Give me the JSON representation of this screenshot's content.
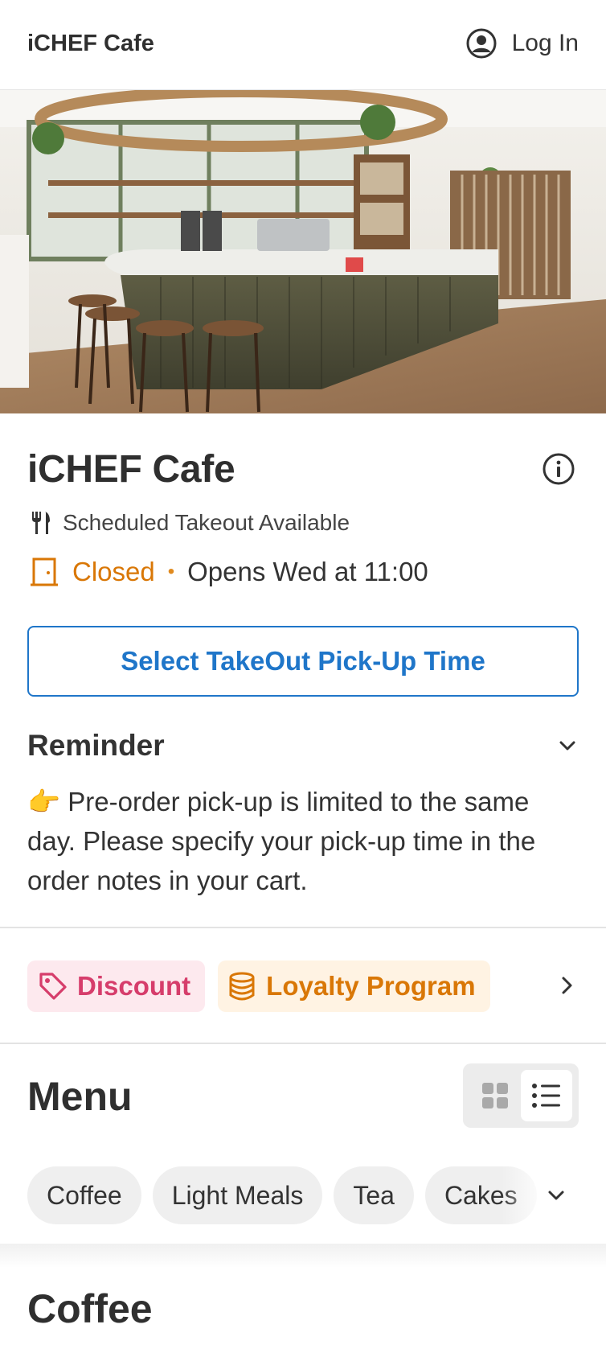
{
  "header": {
    "brand": "iCHEF Cafe",
    "login_label": "Log In",
    "login_icon": "user-circle-icon"
  },
  "hero": {
    "icon": "cafe-interior-photo"
  },
  "store": {
    "name": "iCHEF Cafe",
    "info_icon": "info-icon",
    "takeout_text": "Scheduled Takeout Available",
    "status": "Closed",
    "separator": "•",
    "opens_text": "Opens Wed at 11:00",
    "status_color": "#d97706"
  },
  "pickup_button": {
    "label": "Select TakeOut Pick-Up Time",
    "color": "#1f76c9"
  },
  "reminder": {
    "title": "Reminder",
    "body": "👉  Pre-order pick-up is limited to the same day. Please specify your pick-up time in the order notes in your cart."
  },
  "promotions": {
    "discount_label": "Discount",
    "discount_color": "#d63d6b",
    "loyalty_label": "Loyalty Program",
    "loyalty_color": "#d97706"
  },
  "menu": {
    "title": "Menu",
    "view_modes": [
      "grid",
      "list"
    ],
    "active_view": "list",
    "categories": [
      {
        "label": "Coffee"
      },
      {
        "label": "Light Meals"
      },
      {
        "label": "Tea"
      },
      {
        "label": "Cakes"
      }
    ],
    "section_title": "Coffee"
  }
}
